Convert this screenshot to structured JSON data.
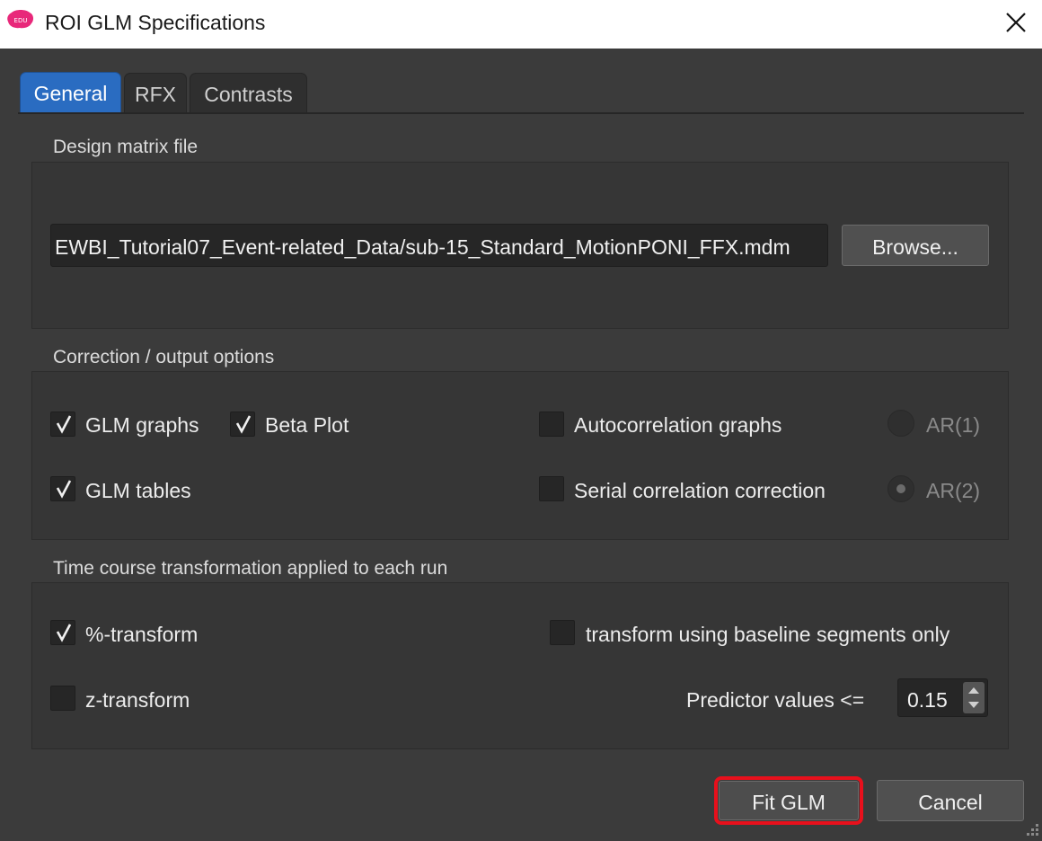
{
  "window": {
    "title": "ROI GLM Specifications",
    "app_icon": "edu-brain-icon",
    "app_icon_text": "EDU",
    "close_icon": "close-icon"
  },
  "tabs": [
    {
      "label": "General",
      "active": true
    },
    {
      "label": "RFX",
      "active": false
    },
    {
      "label": "Contrasts",
      "active": false
    }
  ],
  "design_matrix": {
    "group_label": "Design matrix file",
    "path": "EWBI_Tutorial07_Event-related_Data/sub-15_Standard_MotionPONI_FFX.mdm",
    "browse_label": "Browse..."
  },
  "correction": {
    "group_label": "Correction / output options",
    "glm_graphs": {
      "label": "GLM graphs",
      "checked": true
    },
    "beta_plot": {
      "label": "Beta Plot",
      "checked": true
    },
    "glm_tables": {
      "label": "GLM tables",
      "checked": true
    },
    "autocorrelation": {
      "label": "Autocorrelation graphs",
      "checked": false
    },
    "serial_correction": {
      "label": "Serial correlation correction",
      "checked": false
    },
    "ar1": {
      "label": "AR(1)",
      "selected": false,
      "enabled": false
    },
    "ar2": {
      "label": "AR(2)",
      "selected": true,
      "enabled": false
    }
  },
  "timecourse": {
    "group_label": "Time course transformation applied to each run",
    "percent": {
      "label": "%-transform",
      "checked": true
    },
    "z": {
      "label": "z-transform",
      "checked": false
    },
    "baseline": {
      "label": "transform using baseline segments only",
      "checked": false
    },
    "predictor_label": "Predictor values <=",
    "predictor_value": "0.15"
  },
  "buttons": {
    "fit": "Fit GLM",
    "cancel": "Cancel"
  },
  "colors": {
    "accent_tab": "#2a6cc1",
    "highlight": "#e8101c",
    "background": "#3b3b3b"
  }
}
